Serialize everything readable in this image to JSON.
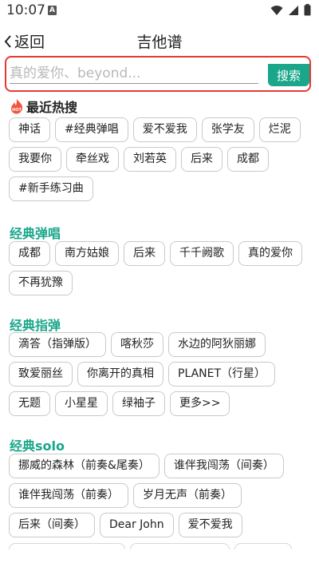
{
  "status": {
    "time": "10:07",
    "a_badge": "A"
  },
  "header": {
    "back_label": "返回",
    "title": "吉他谱"
  },
  "search": {
    "placeholder": "真的爱你、beyond...",
    "value": "",
    "button_label": "搜索"
  },
  "hot": {
    "icon_badge": "HOT",
    "title": "最近热搜",
    "items": [
      "神话",
      "#经典弹唱",
      "爱不爱我",
      "张学友",
      "烂泥",
      "我要你",
      "牵丝戏",
      "刘若英",
      "后来",
      "成都",
      "#新手练习曲"
    ]
  },
  "sections": [
    {
      "title": "经典弹唱",
      "items": [
        "成都",
        "南方姑娘",
        "后来",
        "千千阙歌",
        "真的爱你",
        "不再犹豫"
      ]
    },
    {
      "title": "经典指弹",
      "items": [
        "滴答（指弹版）",
        "喀秋莎",
        "水边的阿狄丽娜",
        "致爱丽丝",
        "你离开的真相",
        "PLANET（行星）",
        "无题",
        "小星星",
        "绿袖子",
        "更多>>"
      ]
    },
    {
      "title": "经典solo",
      "items": [
        "挪威的森林（前奏&尾奏）",
        "谁伴我闯荡（间奏）",
        "谁伴我闯荡（前奏）",
        "岁月无声（前奏）",
        "后来（间奏）",
        "Dear John",
        "爱不爱我"
      ]
    }
  ]
}
